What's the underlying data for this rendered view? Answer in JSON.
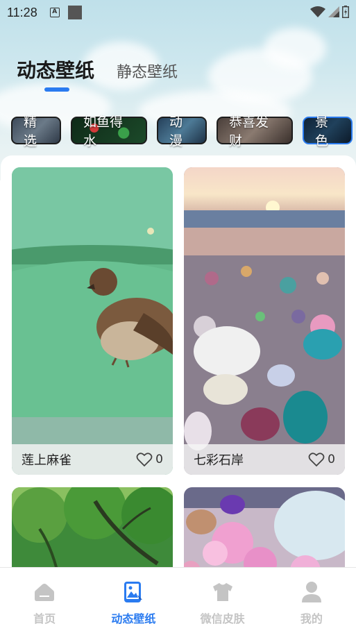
{
  "status_bar": {
    "time": "11:28",
    "a_icon_letter": "A"
  },
  "header": {
    "tabs": [
      {
        "label": "动态壁纸",
        "active": true
      },
      {
        "label": "静态壁纸",
        "active": false
      }
    ]
  },
  "categories": [
    {
      "label": "精选",
      "selected": false
    },
    {
      "label": "如鱼得水",
      "selected": false
    },
    {
      "label": "动漫",
      "selected": false
    },
    {
      "label": "恭喜发财",
      "selected": false
    },
    {
      "label": "景色",
      "selected": true
    }
  ],
  "wallpapers": [
    {
      "title": "莲上麻雀",
      "likes": "0",
      "icon": "heart-outline-icon"
    },
    {
      "title": "七彩石岸",
      "likes": "0",
      "icon": "heart-outline-icon"
    },
    {
      "title": "",
      "likes": ""
    },
    {
      "title": "",
      "likes": ""
    }
  ],
  "bottom_nav": {
    "items": [
      {
        "label": "首页",
        "icon": "home-icon",
        "active": false
      },
      {
        "label": "动态壁纸",
        "icon": "live-wallpaper-icon",
        "active": true
      },
      {
        "label": "微信皮肤",
        "icon": "tshirt-icon",
        "active": false
      },
      {
        "label": "我的",
        "icon": "user-icon",
        "active": false
      }
    ]
  },
  "colors": {
    "accent": "#2a7bf0",
    "inactive_nav": "#c4c4c4"
  }
}
